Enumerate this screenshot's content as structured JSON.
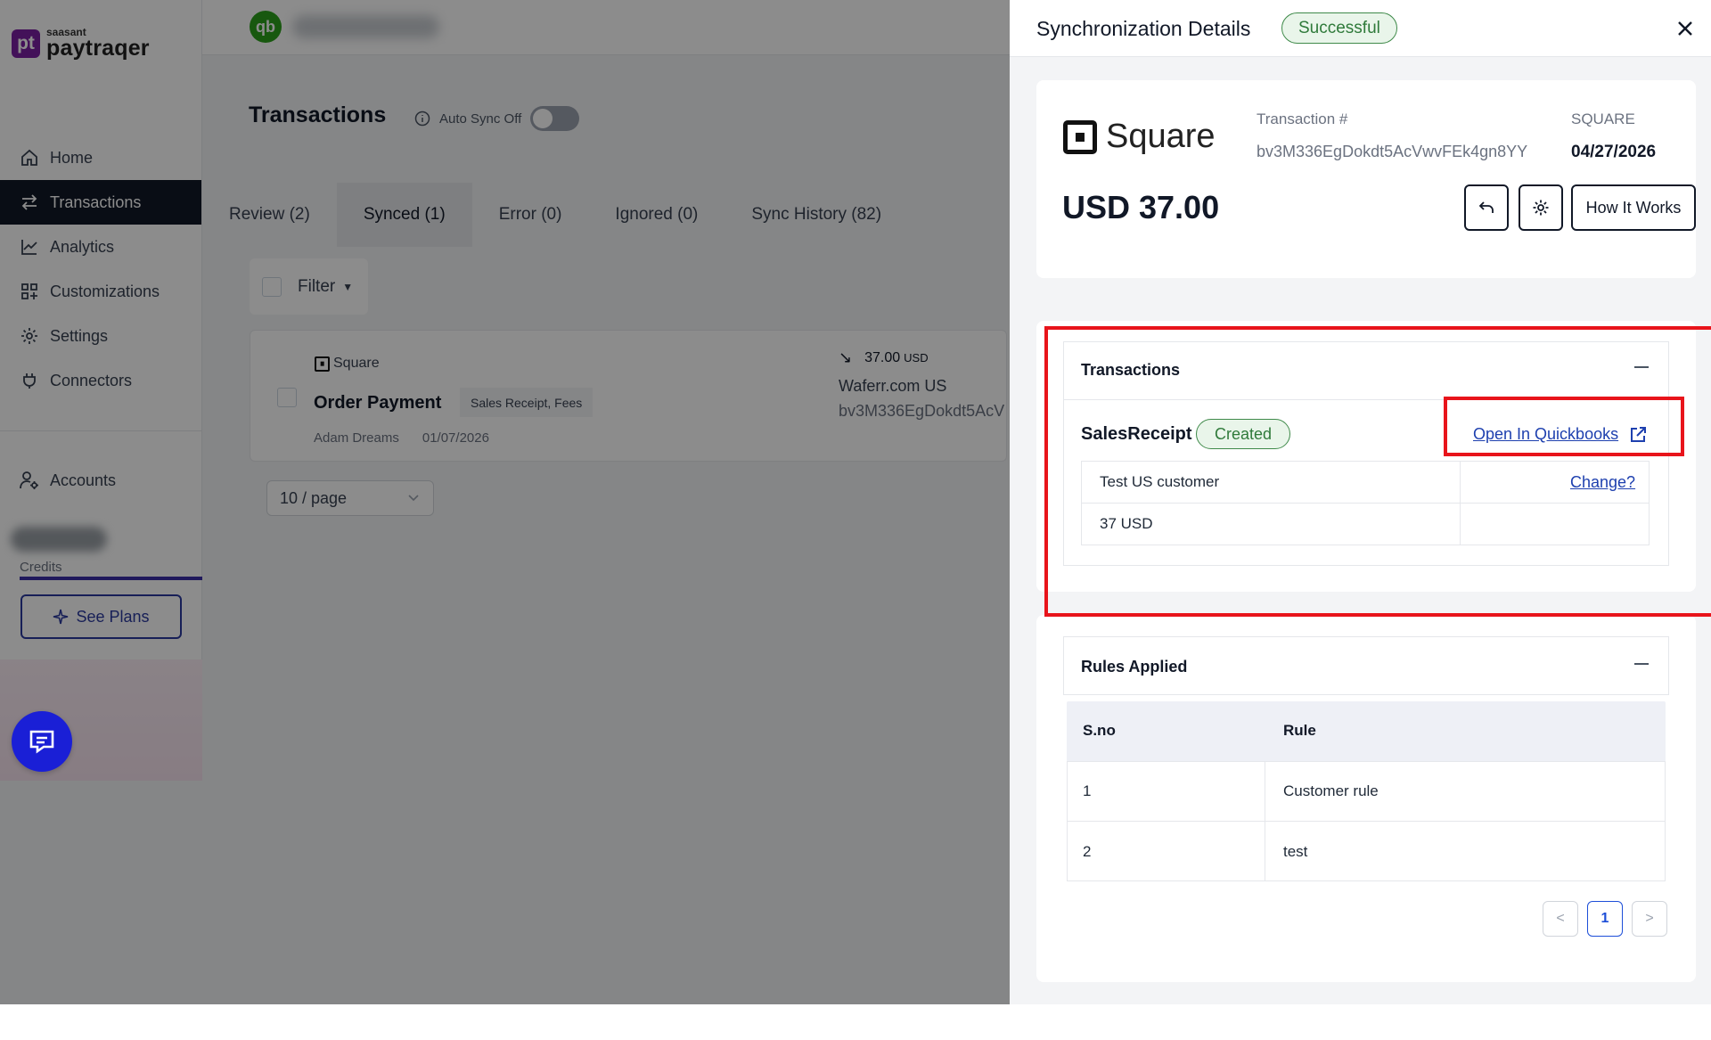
{
  "brand": {
    "top": "saasant",
    "name": "paytraqer",
    "badge": "pt"
  },
  "sidebar": {
    "items": [
      {
        "label": "Home",
        "icon": "home-icon",
        "active": false
      },
      {
        "label": "Transactions",
        "icon": "swap-arrows-icon",
        "active": true
      },
      {
        "label": "Analytics",
        "icon": "chart-line-icon",
        "active": false
      },
      {
        "label": "Customizations",
        "icon": "grid-plus-icon",
        "active": false
      },
      {
        "label": "Settings",
        "icon": "gear-icon",
        "active": false
      },
      {
        "label": "Connectors",
        "icon": "plug-icon",
        "active": false
      }
    ],
    "accounts": {
      "label": "Accounts",
      "icon": "user-gear-icon"
    },
    "credits_label": "Credits",
    "see_plans_label": "See Plans",
    "chat_icon": "chat-icon"
  },
  "topbar": {
    "qb_logo_text": "qb"
  },
  "transactions_page": {
    "title": "Transactions",
    "auto_sync_label": "Auto Sync Off",
    "auto_sync_on": false,
    "tabs": [
      {
        "label": "Review (2)",
        "active": false
      },
      {
        "label": "Synced (1)",
        "active": true
      },
      {
        "label": "Error (0)",
        "active": false
      },
      {
        "label": "Ignored (0)",
        "active": false
      },
      {
        "label": "Sync History (82)",
        "active": false
      }
    ],
    "filter_label": "Filter",
    "transaction": {
      "source": "Square",
      "name": "Order Payment",
      "tag": "Sales Receipt, Fees",
      "customer": "Adam Dreams",
      "date": "01/07/2026",
      "amount": "37.00",
      "currency": "USD",
      "merchant": "Waferr.com US",
      "id": "bv3M336EgDokdt5AcV"
    },
    "page_size": "10 / page"
  },
  "drawer": {
    "title": "Synchronization Details",
    "status": "Successful",
    "source_logo": "Square",
    "transaction_label": "Transaction #",
    "transaction_number": "bv3M336EgDokdt5AcVwvFEk4gn8YY",
    "source_label": "SQUARE",
    "date": "04/27/2026",
    "amount": "USD 37.00",
    "how_it_works": "How It Works",
    "transactions_section": {
      "heading": "Transactions",
      "type": "SalesReceipt",
      "status": "Created",
      "open_link": "Open In Quickbooks",
      "rows": [
        {
          "left": "Test US customer",
          "right": "Change?"
        },
        {
          "left": "37 USD",
          "right": ""
        }
      ]
    },
    "rules_section": {
      "heading": "Rules Applied",
      "columns": [
        "S.no",
        "Rule"
      ],
      "rows": [
        {
          "sno": "1",
          "rule": "Customer rule"
        },
        {
          "sno": "2",
          "rule": "test"
        }
      ],
      "pagination": {
        "prev": "<",
        "current": "1",
        "next": ">"
      }
    }
  },
  "colors": {
    "sidebar_active": "#111827",
    "success_green": "#2f7a3a",
    "link_blue": "#1e40af",
    "highlight_red": "#e8141b",
    "brand_purple": "#7b1fa2",
    "chat_blue": "#1a1fd6"
  }
}
